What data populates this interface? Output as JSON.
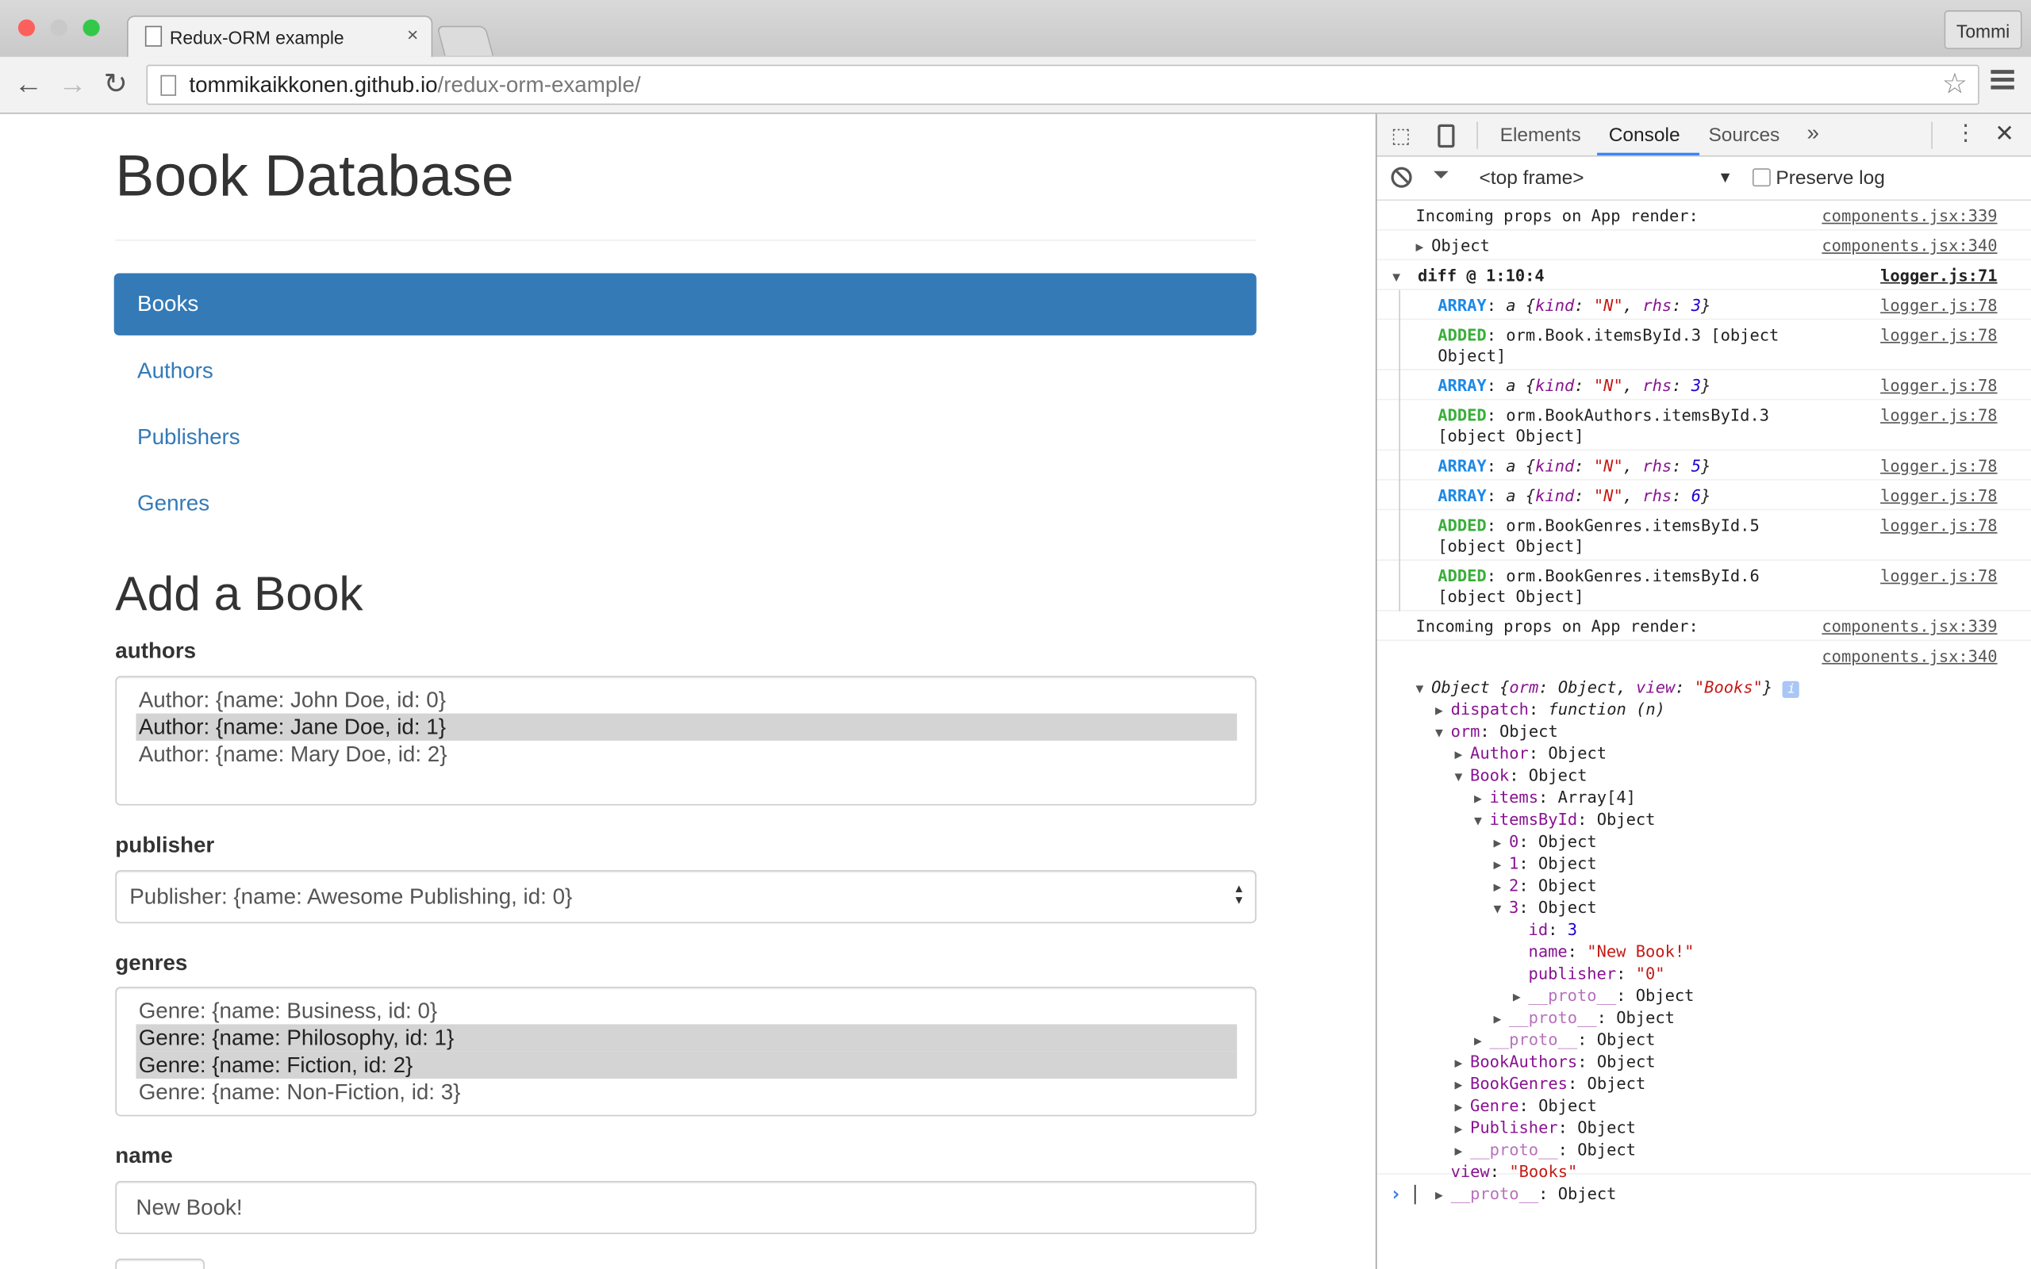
{
  "browser": {
    "tab_title": "Redux-ORM example",
    "tab_close": "×",
    "user": "Tommi",
    "url_host": "tommikaikkonen.github.io",
    "url_path": "/redux-orm-example/"
  },
  "page": {
    "title": "Book Database",
    "nav": [
      {
        "label": "Books",
        "active": true
      },
      {
        "label": "Authors"
      },
      {
        "label": "Publishers"
      },
      {
        "label": "Genres"
      }
    ],
    "form_title": "Add a Book",
    "authors": {
      "label": "authors",
      "options": [
        {
          "text": "Author: {name: John Doe, id: 0}",
          "selected": false
        },
        {
          "text": "Author: {name: Jane Doe, id: 1}",
          "selected": true
        },
        {
          "text": "Author: {name: Mary Doe, id: 2}",
          "selected": false
        }
      ]
    },
    "publisher": {
      "label": "publisher",
      "value": "Publisher: {name: Awesome Publishing, id: 0}"
    },
    "genres": {
      "label": "genres",
      "options": [
        {
          "text": "Genre: {name: Business, id: 0}",
          "selected": false
        },
        {
          "text": "Genre: {name: Philosophy, id: 1}",
          "selected": true
        },
        {
          "text": "Genre: {name: Fiction, id: 2}",
          "selected": true
        },
        {
          "text": "Genre: {name: Non-Fiction, id: 3}",
          "selected": false
        }
      ]
    },
    "name": {
      "label": "name",
      "value": "New Book!"
    }
  },
  "devtools": {
    "tabs": [
      "Elements",
      "Console",
      "Sources"
    ],
    "active_tab": "Console",
    "more": "»",
    "context": "<top frame>",
    "preserve_log": "Preserve log",
    "preserve_checked": false,
    "log1": {
      "text": "Incoming props on App render:",
      "src": "components.jsx:339"
    },
    "log2": {
      "text": "Object",
      "src": "components.jsx:340"
    },
    "diff": {
      "text": "diff @ 1:10:4",
      "src": "logger.js:71"
    },
    "diff_entries": [
      {
        "type": "ARRAY",
        "text": "a {kind: \"N\", rhs: 3}",
        "rhs": "3",
        "src": "logger.js:78"
      },
      {
        "type": "ADDED",
        "text": "orm.Book.itemsById.3 [object Object]",
        "src": "logger.js:78"
      },
      {
        "type": "ARRAY",
        "text": "a {kind: \"N\", rhs: 3}",
        "rhs": "3",
        "src": "logger.js:78"
      },
      {
        "type": "ADDED",
        "text": "orm.BookAuthors.itemsById.3 [object Object]",
        "src": "logger.js:78"
      },
      {
        "type": "ARRAY",
        "text": "a {kind: \"N\", rhs: 5}",
        "rhs": "5",
        "src": "logger.js:78"
      },
      {
        "type": "ARRAY",
        "text": "a {kind: \"N\", rhs: 6}",
        "rhs": "6",
        "src": "logger.js:78"
      },
      {
        "type": "ADDED",
        "text": "orm.BookGenres.itemsById.5 [object Object]",
        "src": "logger.js:78"
      },
      {
        "type": "ADDED",
        "text": "orm.BookGenres.itemsById.6 [object Object]",
        "src": "logger.js:78"
      }
    ],
    "log3": {
      "text": "Incoming props on App render:",
      "src": "components.jsx:339"
    },
    "log4": {
      "src": "components.jsx:340"
    },
    "tree": [
      {
        "depth": 0,
        "arrow": "down",
        "key": "",
        "value": "Object {orm: Object, view: \"Books\"}",
        "info": "i"
      },
      {
        "depth": 1,
        "arrow": "right",
        "key": "dispatch",
        "value": "function (n)",
        "vstyle": "fn"
      },
      {
        "depth": 1,
        "arrow": "down",
        "key": "orm",
        "value": "Object"
      },
      {
        "depth": 2,
        "arrow": "right",
        "key": "Author",
        "value": "Object"
      },
      {
        "depth": 2,
        "arrow": "down",
        "key": "Book",
        "value": "Object"
      },
      {
        "depth": 3,
        "arrow": "right",
        "key": "items",
        "value": "Array[4]"
      },
      {
        "depth": 3,
        "arrow": "down",
        "key": "itemsById",
        "value": "Object"
      },
      {
        "depth": 4,
        "arrow": "right",
        "key": "0",
        "value": "Object"
      },
      {
        "depth": 4,
        "arrow": "right",
        "key": "1",
        "value": "Object"
      },
      {
        "depth": 4,
        "arrow": "right",
        "key": "2",
        "value": "Object"
      },
      {
        "depth": 4,
        "arrow": "down",
        "key": "3",
        "value": "Object"
      },
      {
        "depth": 5,
        "arrow": "none",
        "key": "id",
        "value": "3",
        "vstyle": "num"
      },
      {
        "depth": 5,
        "arrow": "none",
        "key": "name",
        "value": "\"New Book!\"",
        "vstyle": "str"
      },
      {
        "depth": 5,
        "arrow": "none",
        "key": "publisher",
        "value": "\"0\"",
        "vstyle": "str"
      },
      {
        "depth": 5,
        "arrow": "right",
        "key": "__proto__",
        "value": "Object",
        "kstyle": "dim"
      },
      {
        "depth": 4,
        "arrow": "right",
        "key": "__proto__",
        "value": "Object",
        "kstyle": "dim"
      },
      {
        "depth": 3,
        "arrow": "right",
        "key": "__proto__",
        "value": "Object",
        "kstyle": "dim"
      },
      {
        "depth": 2,
        "arrow": "right",
        "key": "BookAuthors",
        "value": "Object"
      },
      {
        "depth": 2,
        "arrow": "right",
        "key": "BookGenres",
        "value": "Object"
      },
      {
        "depth": 2,
        "arrow": "right",
        "key": "Genre",
        "value": "Object"
      },
      {
        "depth": 2,
        "arrow": "right",
        "key": "Publisher",
        "value": "Object"
      },
      {
        "depth": 2,
        "arrow": "right",
        "key": "__proto__",
        "value": "Object",
        "kstyle": "dim"
      },
      {
        "depth": 1,
        "arrow": "none",
        "key": "view",
        "value": "\"Books\"",
        "vstyle": "str"
      },
      {
        "depth": 1,
        "arrow": "right",
        "key": "__proto__",
        "value": "Object",
        "kstyle": "dim"
      }
    ],
    "prompt": "›",
    "colors": {
      "array": "#1e88e5",
      "added": "#3aae3a",
      "key": "#881391",
      "string": "#c41a16",
      "number": "#1c00cf"
    }
  }
}
